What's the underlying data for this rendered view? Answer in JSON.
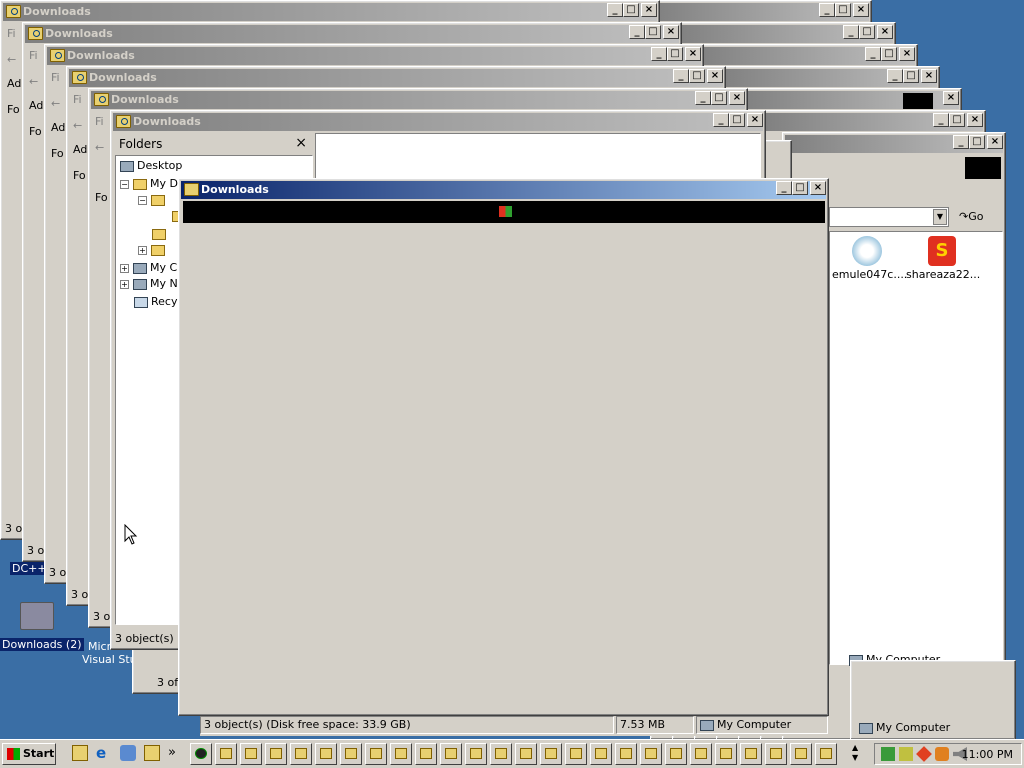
{
  "window_title": "Downloads",
  "folders_pane": {
    "header": "Folders",
    "close": "×",
    "tree": [
      {
        "label": "Desktop"
      },
      {
        "label": "My D"
      },
      {
        "label": "My C"
      },
      {
        "label": "My N"
      },
      {
        "label": "Recy"
      }
    ]
  },
  "address": {
    "go_label": "Go"
  },
  "files": [
    {
      "name": "emule047c...."
    },
    {
      "name": "shareaza22..."
    }
  ],
  "statusbar": {
    "objects": "3 object(s) (Disk free space: 33.9 GB)",
    "size": "7.53 MB",
    "location": "My Computer",
    "objects_short": "3 object(s) (",
    "cascade_obj": "3 ol",
    "cascade_obj2": "3 ob",
    "cascade_obj3": "3 of"
  },
  "background_window_labels": [
    "Fi",
    "Ad",
    "Fo"
  ],
  "desktop": {
    "icons": [
      {
        "label": "DC++"
      },
      {
        "label": "Downloads (2)"
      },
      {
        "label": "Micr"
      },
      {
        "label": "Visual Stu"
      }
    ]
  },
  "taskbar": {
    "start_label": "Start",
    "chevron": "»",
    "clock": "11:00 PM"
  }
}
